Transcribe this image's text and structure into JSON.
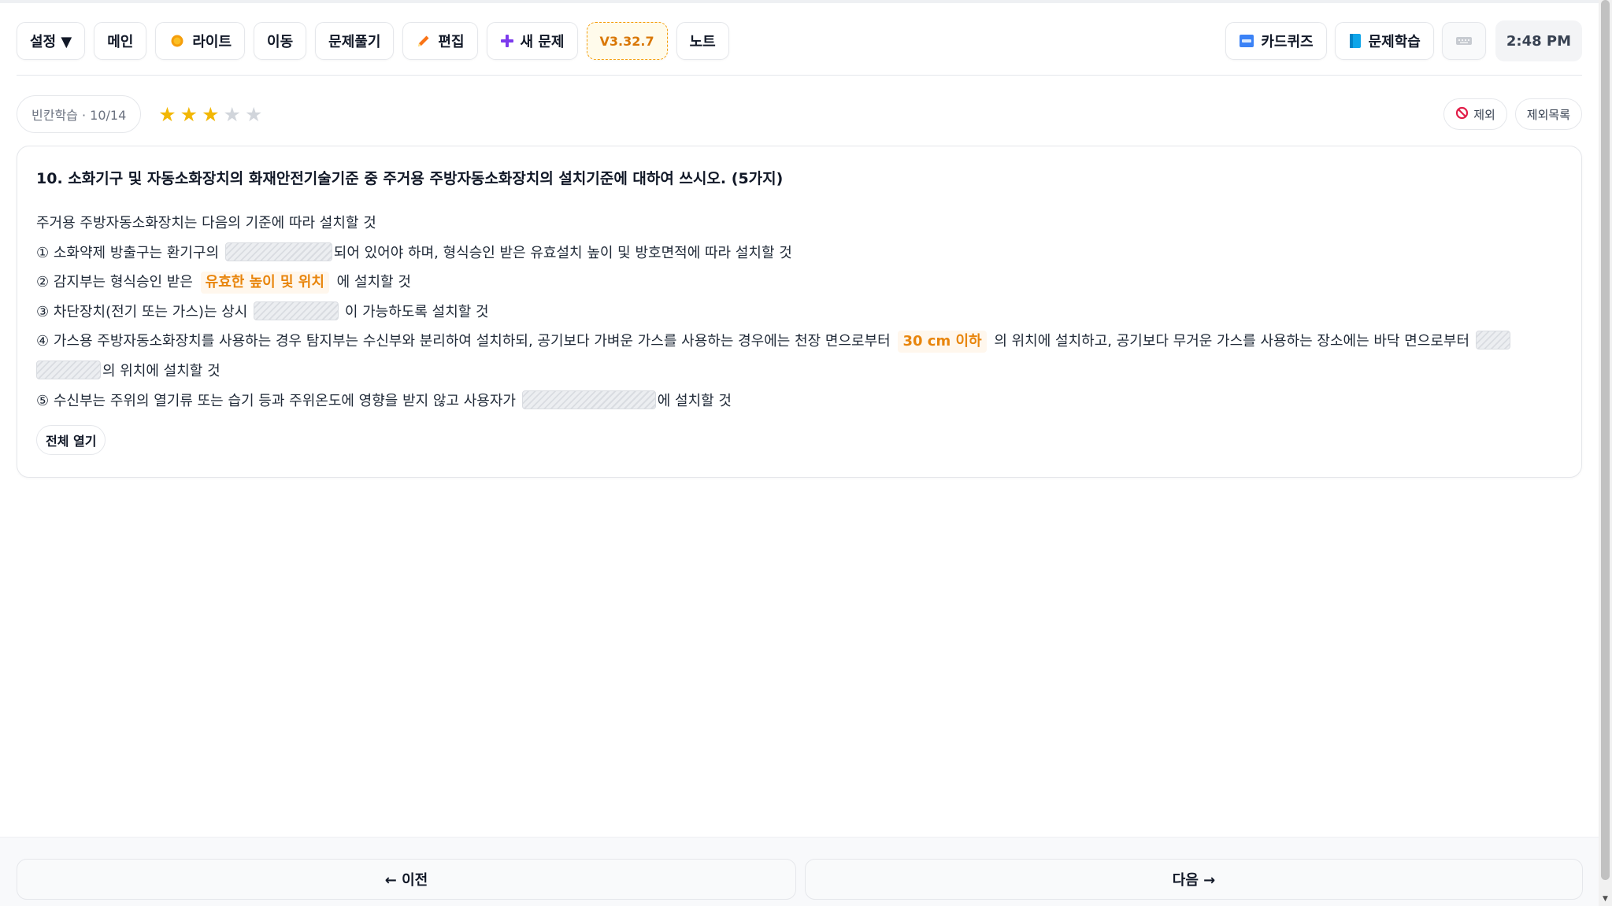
{
  "toolbar": {
    "settings_label": "설정 ▼",
    "main_label": "메인",
    "light_label": "라이트",
    "move_label": "이동",
    "solve_label": "문제풀기",
    "edit_label": "편집",
    "new_problem_label": "새 문제",
    "version_label": "V3.32.7",
    "note_label": "노트",
    "card_quiz_label": "카드퀴즈",
    "problem_study_label": "문제학습",
    "time": "2:48 PM"
  },
  "status": {
    "mode_label": "빈칸학습 · 10/14",
    "rating": 3,
    "rating_max": 5,
    "exclude_label": "제외",
    "exclude_list_label": "제외목록"
  },
  "question": {
    "title": "10. 소화기구 및 자동소화장치의 화재안전기술기준 중 주거용 주방자동소화장치의 설치기준에 대하여 쓰시오. (5가지)",
    "intro": "주거용 주방자동소화장치는 다음의 기준에 따라 설치할 것",
    "l1_pre": "① 소화약제 방출구는 환기구의",
    "l1_post": "되어 있어야 하며, 형식승인 받은 유효설치 높이 및 방호면적에 따라 설치할 것",
    "l2_pre": "② 감지부는 형식승인 받은",
    "l2_reveal": "유효한 높이 및 위치",
    "l2_post": "에 설치할 것",
    "l3_pre": "③ 차단장치(전기 또는 가스)는 상시",
    "l3_post": "이 가능하도록 설치할 것",
    "l4_pre": "④ 가스용 주방자동소화장치를 사용하는 경우 탐지부는 수신부와 분리하여 설치하되, 공기보다 가벼운 가스를 사용하는 경우에는 천장 면으로부터",
    "l4_reveal": "30 cm 이하",
    "l4_mid": "의 위치에 설치하고, 공기보다 무거운 가스를 사용하는 장소에는 바닥 면으로부터",
    "l4_post": "의 위치에 설치할 것",
    "l5_pre": "⑤ 수신부는 주위의 열기류 또는 습기 등과 주위온도에 영향을 받지 않고 사용자가",
    "l5_post": "에 설치할 것",
    "open_all_label": "전체 열기"
  },
  "nav": {
    "prev_label": "← 이전",
    "next_label": "다음 →"
  },
  "colors": {
    "accent_orange": "#e8850c",
    "star_active": "#f2b705",
    "star_inactive": "#d1d5db",
    "exclude_red": "#e11d48",
    "card_quiz_blue": "#3b82f6",
    "book_blue": "#0ea5e9",
    "new_problem_purple": "#7c3aed"
  },
  "icons": {
    "light": "sun-icon",
    "edit": "pencil-icon",
    "new_problem": "plus-icon",
    "card_quiz": "abc-icon",
    "problem_study": "book-icon",
    "keyboard": "keyboard-icon",
    "exclude": "prohibited-icon"
  }
}
